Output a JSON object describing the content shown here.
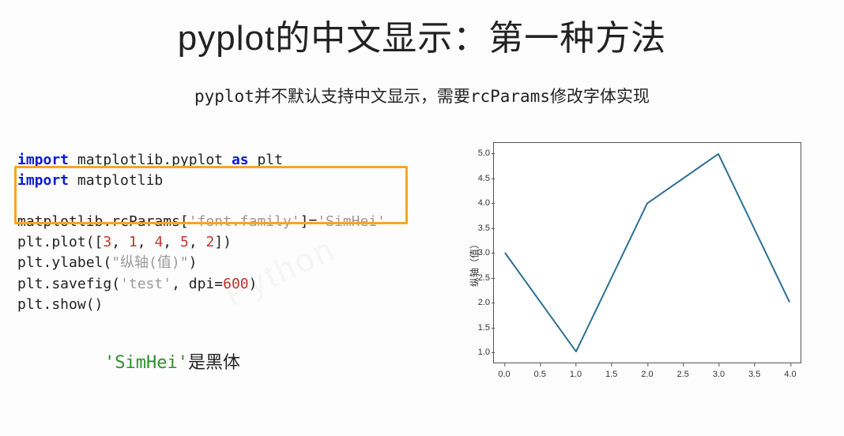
{
  "title": "pyplot的中文显示：第一种方法",
  "subtitle": "pyplot并不默认支持中文显示，需要rcParams修改字体实现",
  "code": {
    "line1_import": "import",
    "line1_rest": " matplotlib.pyplot ",
    "line1_as": "as",
    "line1_alias": " plt",
    "line2_import": "import",
    "line2_rest": " matplotlib",
    "line3_head": "matplotlib.rcParams[",
    "line3_key": "'font.family'",
    "line3_mid": "]=",
    "line3_val": "'SimHei'",
    "line4_head": "plt.plot([",
    "line4_n1": "3",
    "line4_c1": ", ",
    "line4_n2": "1",
    "line4_c2": ", ",
    "line4_n3": "4",
    "line4_c3": ", ",
    "line4_n4": "5",
    "line4_c4": ", ",
    "line4_n5": "2",
    "line4_tail": "])",
    "line5_head": "plt.ylabel(",
    "line5_arg": "\"纵轴(值)\"",
    "line5_tail": ")",
    "line6_head": "plt.savefig(",
    "line6_arg1": "'test'",
    "line6_mid": ", dpi=",
    "line6_arg2": "600",
    "line6_tail": ")",
    "line7": "plt.show()"
  },
  "note": {
    "green": "'SimHei'",
    "rest": "是黑体"
  },
  "chart_data": {
    "type": "line",
    "x": [
      0,
      1,
      2,
      3,
      4
    ],
    "values": [
      3,
      1,
      4,
      5,
      2
    ],
    "ylabel": "纵轴（值）",
    "xlim": [
      0,
      4
    ],
    "ylim": [
      1,
      5
    ],
    "xticks": [
      "0.0",
      "0.5",
      "1.0",
      "1.5",
      "2.0",
      "2.5",
      "3.0",
      "3.5",
      "4.0"
    ],
    "yticks": [
      "1.0",
      "1.5",
      "2.0",
      "2.5",
      "3.0",
      "3.5",
      "4.0",
      "4.5",
      "5.0"
    ],
    "line_color": "#2c6f93"
  },
  "watermark": "Python"
}
